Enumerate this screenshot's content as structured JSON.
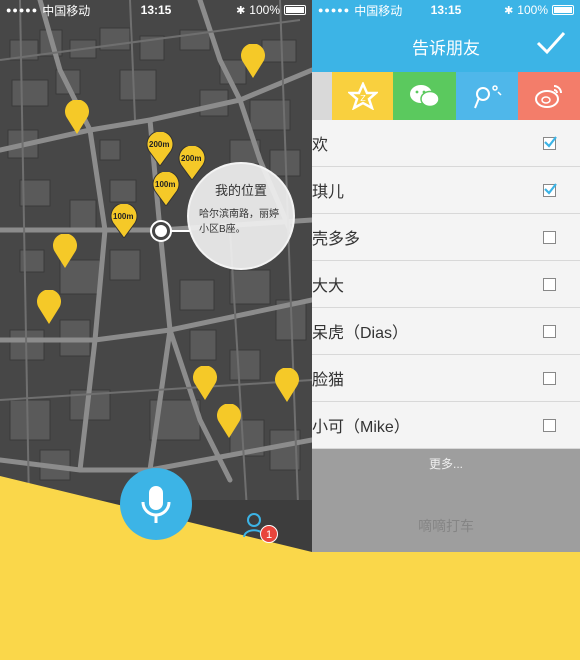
{
  "left_status": {
    "carrier": "中国移动",
    "time": "13:15",
    "battery": "100%",
    "signal_dots": "●●●●●"
  },
  "right_status": {
    "carrier": "中国移动",
    "time": "13:15",
    "battery": "100%",
    "signal_dots": "●●●●●"
  },
  "map": {
    "distance_labels": [
      "200m",
      "200m",
      "100m",
      "100m"
    ],
    "location_bubble": {
      "title": "我的位置",
      "address": "哈尔滨南路，丽婷小区B座。"
    }
  },
  "bottom_bar": {
    "notification_count": "1"
  },
  "share_panel": {
    "title": "告诉朋友",
    "tabs": [
      {
        "name": "favorites",
        "icon": "star-icon",
        "color": "#f9d03e"
      },
      {
        "name": "wechat",
        "icon": "wechat-icon",
        "color": "#5bc95e"
      },
      {
        "name": "moments",
        "icon": "moments-icon",
        "color": "#4fb7ea"
      },
      {
        "name": "weibo",
        "icon": "weibo-icon",
        "color": "#f37d6a"
      }
    ],
    "friends": [
      {
        "name": "欢",
        "checked": true
      },
      {
        "name": "琪儿",
        "checked": true
      },
      {
        "name": "壳多多",
        "checked": false
      },
      {
        "name": "大大",
        "checked": false
      },
      {
        "name": "呆虎（Dias）",
        "checked": false
      },
      {
        "name": "脸猫",
        "checked": false
      },
      {
        "name": "小可（Mike）",
        "checked": false
      }
    ],
    "more_label": "更多...",
    "bottom_label": "嘀嘀打车"
  },
  "colors": {
    "accent_blue": "#3cb4e6",
    "accent_yellow": "#fad74a",
    "map_bg": "#4a4a4a"
  }
}
